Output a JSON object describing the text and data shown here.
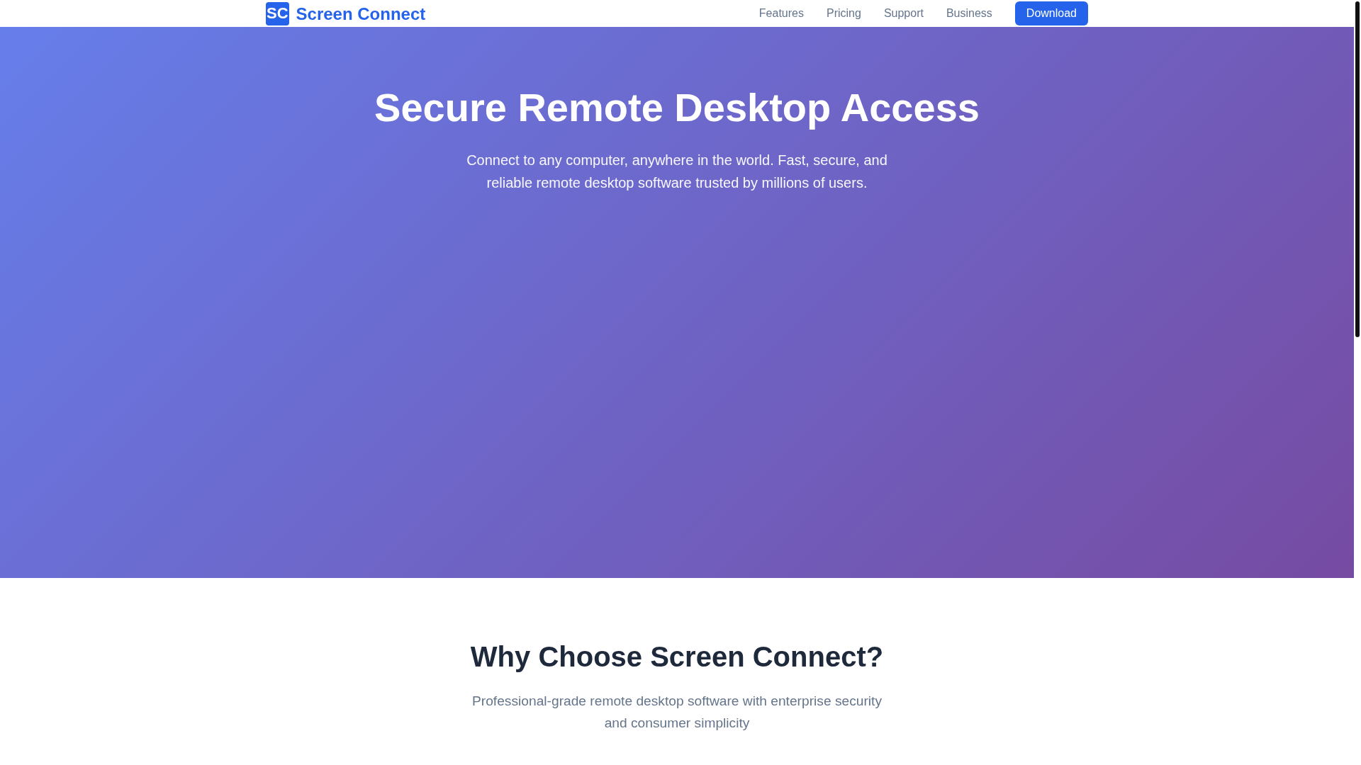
{
  "header": {
    "logo": {
      "badge": "SC",
      "name": "Screen Connect"
    },
    "nav": [
      "Features",
      "Pricing",
      "Support",
      "Business"
    ],
    "cta": "Download"
  },
  "hero": {
    "title": "Secure Remote Desktop Access",
    "subtitle": "Connect to any computer, anywhere in the world. Fast, secure, and reliable remote desktop software trusted by millions of users."
  },
  "features": {
    "title": "Why Choose Screen Connect?",
    "subtitle": "Professional-grade remote desktop software with enterprise security and consumer simplicity"
  }
}
